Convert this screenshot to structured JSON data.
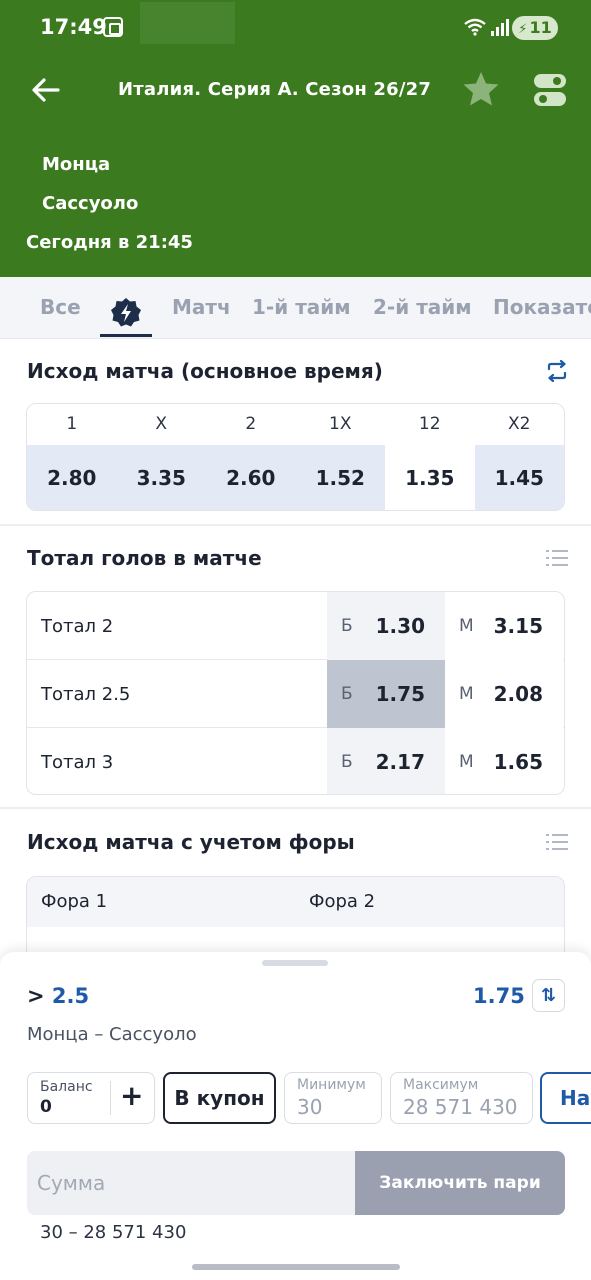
{
  "status_bar": {
    "time": "17:49",
    "battery": "11"
  },
  "header": {
    "title": "Италия. Серия А. Сезон 26/27",
    "team1": "Монца",
    "team2": "Сассуоло",
    "match_time": "Сегодня в 21:45"
  },
  "tabs": [
    "Все",
    "Матч",
    "1-й тайм",
    "2-й тайм",
    "Показате"
  ],
  "outcome": {
    "title": "Исход матча (основное время)",
    "labels": [
      "1",
      "X",
      "2",
      "1X",
      "12",
      "X2"
    ],
    "values": [
      "2.80",
      "3.35",
      "2.60",
      "1.52",
      "1.35",
      "1.45"
    ]
  },
  "totals": {
    "title": "Тотал голов в матче",
    "over_key": "Б",
    "under_key": "М",
    "rows": [
      {
        "label": "Тотал 2",
        "over": "1.30",
        "under": "3.15"
      },
      {
        "label": "Тотал 2.5",
        "over": "1.75",
        "under": "2.08"
      },
      {
        "label": "Тотал 3",
        "over": "2.17",
        "under": "1.65"
      }
    ]
  },
  "handicap": {
    "title": "Исход матча с учетом форы",
    "col1": "Фора 1",
    "col2": "Фора 2"
  },
  "bet_slip": {
    "outcome_prefix": ">",
    "outcome_value": "2.5",
    "odds": "1.75",
    "match": "Монца – Сассуоло",
    "balance_label": "Баланс",
    "balance_value": "0",
    "to_coupon": "В купон",
    "min_label": "Минимум",
    "min_value": "30",
    "max_label": "Максимум",
    "max_value": "28 571 430",
    "settings_label": "Нас",
    "amount_placeholder": "Сумма",
    "place_bet": "Заключить пари",
    "range": "30 – 28 571 430"
  }
}
